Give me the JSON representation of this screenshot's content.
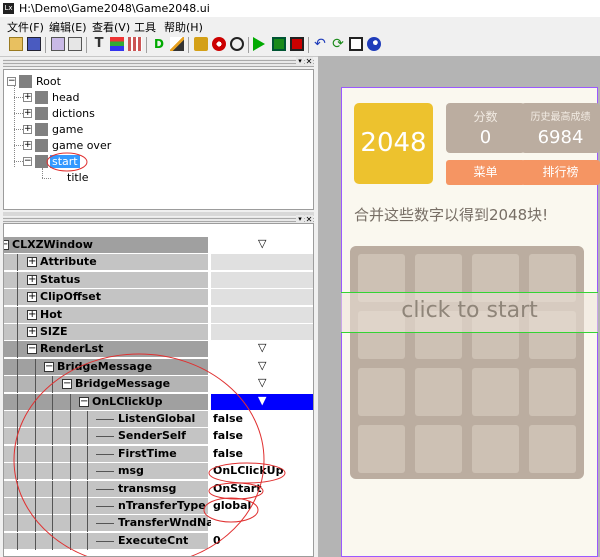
{
  "window": {
    "title": "H:\\Demo\\Game2048\\Game2048.ui"
  },
  "menu": [
    "文件(F)",
    "编辑(E)",
    "查看(V)",
    "工具",
    "帮助(H)"
  ],
  "toolbar_icons": [
    "open-icon",
    "save-icon",
    "image-icon",
    "edit-icon",
    "text-icon",
    "layout-icon",
    "grid-icon",
    "d-icon",
    "brush-icon",
    "lock-icon",
    "eye-icon",
    "power-icon",
    "play-icon",
    "stop-icon",
    "record-icon",
    "undo-icon",
    "refresh-icon",
    "crop-icon",
    "color-icon"
  ],
  "tree": {
    "root": "Root",
    "items": [
      "head",
      "dictions",
      "game",
      "game over",
      "start"
    ],
    "child": "title"
  },
  "props": {
    "rows": [
      {
        "name": "CLXZWindow",
        "value": "▽"
      },
      {
        "name": "Attribute",
        "value": ""
      },
      {
        "name": "Status",
        "value": ""
      },
      {
        "name": "ClipOffset",
        "value": ""
      },
      {
        "name": "Hot",
        "value": ""
      },
      {
        "name": "SIZE",
        "value": ""
      },
      {
        "name": "RenderLst",
        "value": "▽"
      },
      {
        "name": "BridgeMessage",
        "value": "▽"
      },
      {
        "name": "BridgeMessage",
        "value": "▽"
      },
      {
        "name": "OnLClickUp",
        "value": "▼"
      },
      {
        "name": "ListenGlobal",
        "value": "false"
      },
      {
        "name": "SenderSelf",
        "value": "false"
      },
      {
        "name": "FirstTime",
        "value": "false"
      },
      {
        "name": "msg",
        "value": "OnLClickUp"
      },
      {
        "name": "transmsg",
        "value": "OnStart"
      },
      {
        "name": "nTransferType",
        "value": "global"
      },
      {
        "name": "TransferWndNam",
        "value": ""
      },
      {
        "name": "ExecuteCnt",
        "value": "0"
      }
    ]
  },
  "game": {
    "logo": "2048",
    "score_label": "分数",
    "score_value": "0",
    "best_label": "历史最高成绩",
    "best_value": "6984",
    "menu_button": "菜单",
    "rank_button": "排行榜",
    "tip": "合并这些数字以得到2048块!",
    "overlay": "click to start"
  },
  "colors": {
    "selection": "#0000ff",
    "tile_2048": "#edc22e",
    "button": "#f59563",
    "annotation": "#e03030"
  }
}
